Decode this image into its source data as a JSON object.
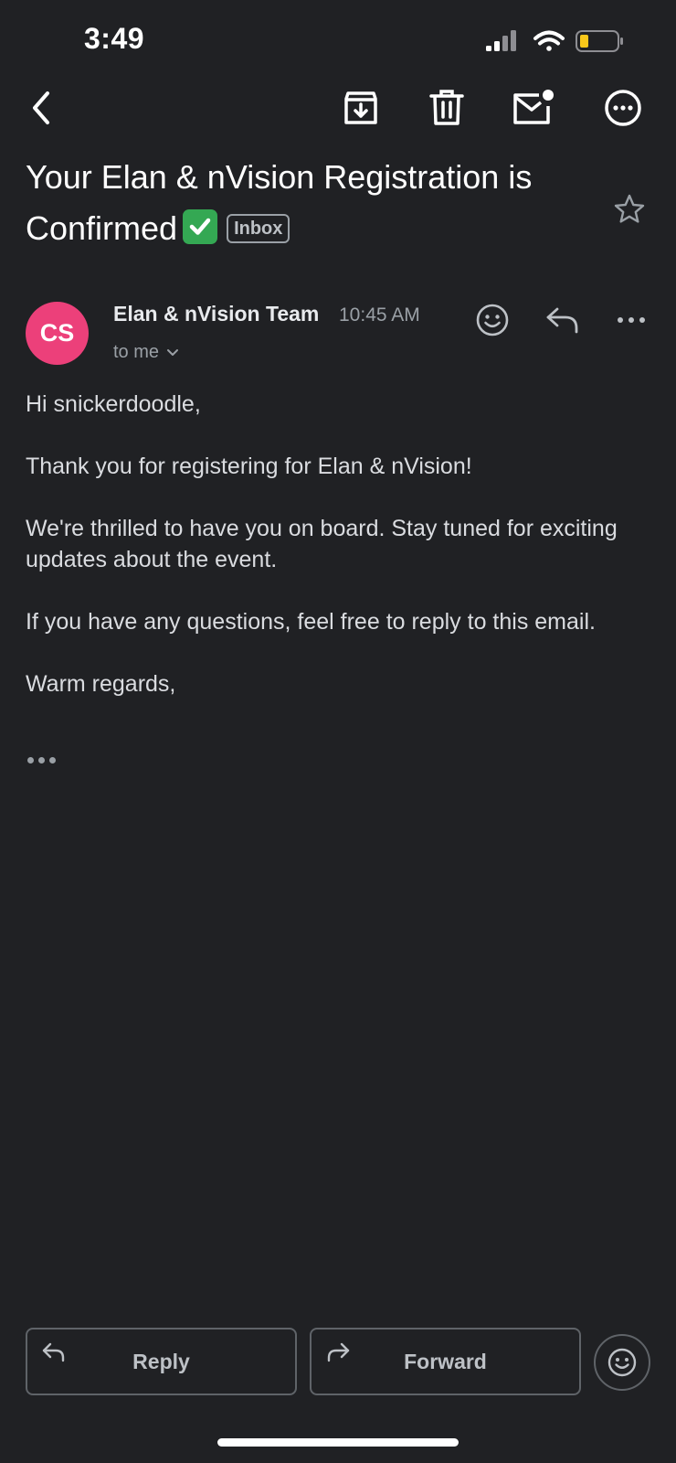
{
  "status_bar": {
    "time": "3:49",
    "icons": [
      "signal-icon",
      "wifi-icon",
      "battery-icon"
    ],
    "battery_color": "#f9c81a"
  },
  "toolbar": {
    "icons": [
      "back-icon",
      "archive-icon",
      "trash-icon",
      "mark-unread-icon",
      "more-options-icon"
    ]
  },
  "subject": {
    "text": "Your Elan & nVision Registration is Confirmed",
    "emoji": "check-mark-emoji",
    "label": "Inbox"
  },
  "sender": {
    "initials": "CS",
    "avatar_color": "#ec407a",
    "name": "Elan & nVision Team",
    "time": "10:45 AM",
    "recipient": "to me"
  },
  "email": {
    "greeting": "Hi snickerdoodle,",
    "paragraphs": [
      "Thank you for registering for Elan & nVision!",
      "We're thrilled to have you on board. Stay tuned for exciting updates about the event.",
      "If you have any questions, feel free to reply to this email."
    ],
    "closing": "Warm regards,"
  },
  "actions": {
    "reply_label": "Reply",
    "forward_label": "Forward"
  },
  "colors": {
    "background": "#202124",
    "text": "#e8eaed",
    "muted": "#9aa0a6"
  }
}
